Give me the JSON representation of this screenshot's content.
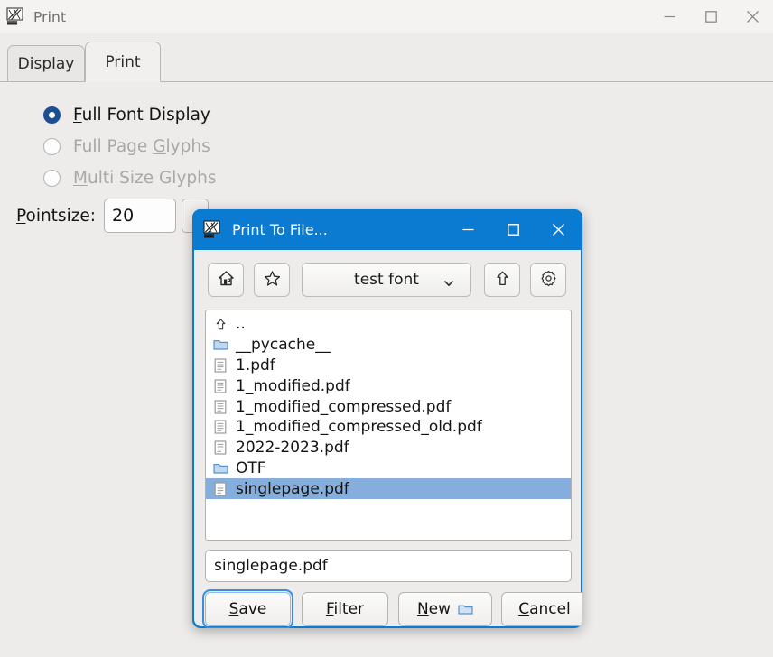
{
  "main_window": {
    "title": "Print",
    "icon": "fontforge-icon",
    "window_buttons": [
      {
        "name": "minimize-button",
        "glyph": "minimize-icon"
      },
      {
        "name": "maximize-button",
        "glyph": "maximize-icon"
      },
      {
        "name": "close-button",
        "glyph": "close-icon"
      }
    ],
    "tabs": [
      {
        "label": "Display",
        "active": false
      },
      {
        "label": "Print",
        "active": true
      }
    ],
    "radio_options": [
      {
        "label_pre": "",
        "accel": "F",
        "label_post": "ull Font Display",
        "selected": true,
        "disabled": false
      },
      {
        "label_pre": "Full Page ",
        "accel": "G",
        "label_post": "lyphs",
        "selected": false,
        "disabled": true
      },
      {
        "label_pre": "",
        "accel": "M",
        "label_post": "ulti Size Glyphs",
        "selected": false,
        "disabled": true
      }
    ],
    "pointsize": {
      "label_accel": "P",
      "label_rest": "ointsize:",
      "value": "20"
    }
  },
  "dialog": {
    "title": "Print To File...",
    "icon": "fontforge-icon",
    "window_buttons": [
      {
        "name": "minimize-button",
        "glyph": "minimize-icon"
      },
      {
        "name": "maximize-button",
        "glyph": "maximize-icon"
      },
      {
        "name": "close-button",
        "glyph": "close-icon"
      }
    ],
    "toolbar": {
      "home_icon": "home-icon",
      "bookmark_icon": "star-icon",
      "path_value": "test font",
      "caret_icon": "chevron-down-icon",
      "up_icon": "up-arrow-icon",
      "settings_icon": "gear-icon"
    },
    "files": [
      {
        "name": "..",
        "icon": "up-arrow-icon",
        "selected": false
      },
      {
        "name": "__pycache__",
        "icon": "folder-icon",
        "selected": false
      },
      {
        "name": "1.pdf",
        "icon": "document-icon",
        "selected": false
      },
      {
        "name": "1_modified.pdf",
        "icon": "document-icon",
        "selected": false
      },
      {
        "name": "1_modified_compressed.pdf",
        "icon": "document-icon",
        "selected": false
      },
      {
        "name": "1_modified_compressed_old.pdf",
        "icon": "document-icon",
        "selected": false
      },
      {
        "name": "2022-2023.pdf",
        "icon": "document-icon",
        "selected": false
      },
      {
        "name": "OTF",
        "icon": "folder-icon",
        "selected": false
      },
      {
        "name": "singlepage.pdf",
        "icon": "document-icon",
        "selected": true
      }
    ],
    "filename_value": "singlepage.pdf",
    "buttons": [
      {
        "name": "save-button",
        "accel": "S",
        "rest": "ave",
        "focused": true,
        "folder_icon": false
      },
      {
        "name": "filter-button",
        "accel": "F",
        "rest": "ilter",
        "focused": false,
        "folder_icon": false
      },
      {
        "name": "new-folder-button",
        "accel": "N",
        "rest": "ew",
        "focused": false,
        "folder_icon": true
      },
      {
        "name": "cancel-button",
        "accel": "C",
        "rest": "ancel",
        "focused": false,
        "folder_icon": false
      }
    ]
  },
  "colors": {
    "dialog_titlebar": "#0b7ad1",
    "selection": "#85aedc",
    "radio_selected": "#1c4f91",
    "window_bg": "#edecea",
    "focus_ring": "#3a8ddd"
  }
}
